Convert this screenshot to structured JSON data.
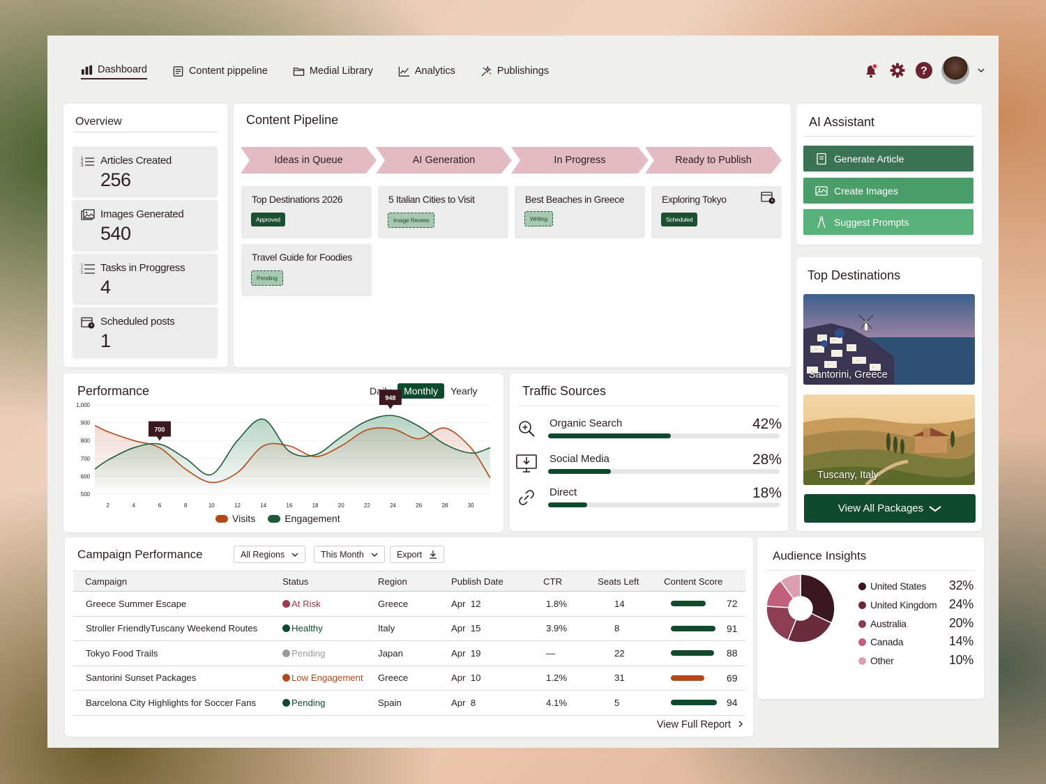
{
  "nav": {
    "items": [
      {
        "label": "Dashboard",
        "icon": "bar-chart-icon"
      },
      {
        "label": "Content pippeline",
        "icon": "document-icon"
      },
      {
        "label": "Medial Library",
        "icon": "folder-icon"
      },
      {
        "label": "Analytics",
        "icon": "line-chart-icon"
      },
      {
        "label": "Publishings",
        "icon": "sparkle-icon"
      }
    ],
    "active": "Dashboard"
  },
  "overview": {
    "title": "Overview",
    "stats": [
      {
        "label": "Articles Created",
        "value": "256",
        "icon": "numbered-list-icon"
      },
      {
        "label": "Images Generated",
        "value": "540",
        "icon": "images-icon"
      },
      {
        "label": "Tasks in Proggress",
        "value": "4",
        "icon": "task-list-icon"
      },
      {
        "label": "Scheduled posts",
        "value": "1",
        "icon": "calendar-clock-icon"
      }
    ]
  },
  "pipeline": {
    "title": "Content Pipeline",
    "stages": [
      "Ideas in Queue",
      "AI Generation",
      "In Progress",
      "Ready to Publish"
    ],
    "tasks": [
      {
        "title": "Top Destinations 2026",
        "badge": "Approved",
        "style": "solid"
      },
      {
        "title": "5 Italian Cities to Visit",
        "badge": "Image Review",
        "style": "dash"
      },
      {
        "title": "Best Beaches in Greece",
        "badge": "Writing",
        "style": "dash"
      },
      {
        "title": "Exploring Tokyo",
        "badge": "Scheduled",
        "style": "solid"
      },
      {
        "title": "Travel Guide for Foodies",
        "badge": "Pending",
        "style": "dash"
      }
    ]
  },
  "ai_assistant": {
    "title": "AI Assistant",
    "buttons": [
      {
        "label": "Generate Article",
        "color": "#3b7355"
      },
      {
        "label": "Create Images",
        "color": "#4b9e6a"
      },
      {
        "label": "Suggest Prompts",
        "color": "#58b07a"
      }
    ]
  },
  "destinations": {
    "title": "Top Destinations",
    "items": [
      "Santorini, Greece",
      "Tuscany, Italy"
    ],
    "view_all": "View All Packages"
  },
  "performance": {
    "title": "Performance",
    "periods": [
      "Daily",
      "Monthly",
      "Yearly"
    ],
    "selected": "Monthly",
    "legend": [
      "Visits",
      "Engagement"
    ]
  },
  "chart_data": {
    "type": "line",
    "title": "Performance",
    "x": [
      1,
      2,
      4,
      6,
      8,
      10,
      12,
      14,
      16,
      18,
      20,
      22,
      24,
      26,
      28,
      30,
      31.5
    ],
    "xticks": [
      2,
      4,
      6,
      8,
      10,
      12,
      14,
      16,
      18,
      20,
      22,
      24,
      26,
      28,
      30
    ],
    "ylim": [
      500,
      1000
    ],
    "yticks": [
      "500",
      "600",
      "700",
      "800",
      "900",
      "1,000"
    ],
    "series": [
      {
        "name": "Visits",
        "color": "#b14a17",
        "values": [
          885,
          850,
          800,
          760,
          640,
          565,
          620,
          770,
          770,
          710,
          770,
          860,
          865,
          810,
          870,
          760,
          590
        ]
      },
      {
        "name": "Engagement",
        "color": "#1d5a3a",
        "values": [
          640,
          690,
          760,
          780,
          700,
          610,
          800,
          920,
          740,
          720,
          820,
          910,
          940,
          880,
          780,
          730,
          760
        ]
      }
    ],
    "annotations": [
      {
        "series": "Visits",
        "x": 6,
        "label": "700"
      },
      {
        "series": "Engagement",
        "x": 23.8,
        "label": "948"
      }
    ],
    "grid": true
  },
  "traffic": {
    "title": "Traffic Sources",
    "sources": [
      {
        "name": "Organic Search",
        "percent": "42%",
        "fill": 0.53,
        "icon": "zoom-in-icon"
      },
      {
        "name": "Social Media",
        "percent": "28%",
        "fill": 0.27,
        "icon": "monitor-download-icon"
      },
      {
        "name": "Direct",
        "percent": "18%",
        "fill": 0.17,
        "icon": "link-icon"
      }
    ]
  },
  "campaign": {
    "title": "Campaign Performance",
    "filters": [
      "All Regions",
      "This Month",
      "Export"
    ],
    "columns": [
      "Campaign",
      "Status",
      "Region",
      "Publish Date",
      "CTR",
      "Seats Left",
      "Content Score"
    ],
    "rows": [
      {
        "campaign": "Greece Summer Escape",
        "status": "At Risk",
        "status_color": "#9a3a4a",
        "region": "Greece",
        "date": "Apr  12",
        "ctr": "1.8%",
        "seats": "14",
        "score": "72",
        "bar_color": "#0f4a2e"
      },
      {
        "campaign": "Stroller FriendlyTuscany Weekend Routes",
        "status": "Healthy",
        "status_color": "#0f4a2e",
        "region": "Italy",
        "date": "Apr  15",
        "ctr": "3.9%",
        "seats": "8",
        "score": "91",
        "bar_color": "#0f4a2e"
      },
      {
        "campaign": "Tokyo Food Trails",
        "status": "Pending",
        "status_color": "#9a9a9a",
        "region": "Japan",
        "date": "Apr  19",
        "ctr": "—",
        "seats": "22",
        "score": "88",
        "bar_color": "#0f4a2e"
      },
      {
        "campaign": "Santorini Sunset Packages",
        "status": "Low Engagement",
        "status_color": "#b14a17",
        "region": "Greece",
        "date": "Apr  10",
        "ctr": "1.2%",
        "seats": "31",
        "score": "69",
        "bar_color": "#b14a17"
      },
      {
        "campaign": "Barcelona City Highlights for Soccer Fans",
        "status": "Pending",
        "status_color": "#0f4a2e",
        "region": "Spain",
        "date": "Apr  8",
        "ctr": "4.1%",
        "seats": "5",
        "score": "94",
        "bar_color": "#0f4a2e"
      }
    ],
    "footer_link": "View Full Report"
  },
  "audience": {
    "title": "Audience Insights",
    "segments": [
      {
        "name": "United States",
        "percent": "32%",
        "value": 32,
        "color": "#3b1820"
      },
      {
        "name": "United Kingdom",
        "percent": "24%",
        "value": 24,
        "color": "#6a2c3a"
      },
      {
        "name": "Australia",
        "percent": "20%",
        "value": 20,
        "color": "#8c3f52"
      },
      {
        "name": "Canada",
        "percent": "14%",
        "value": 14,
        "color": "#c25f7a"
      },
      {
        "name": "Other",
        "percent": "10%",
        "value": 10,
        "color": "#dba0ae"
      }
    ]
  }
}
